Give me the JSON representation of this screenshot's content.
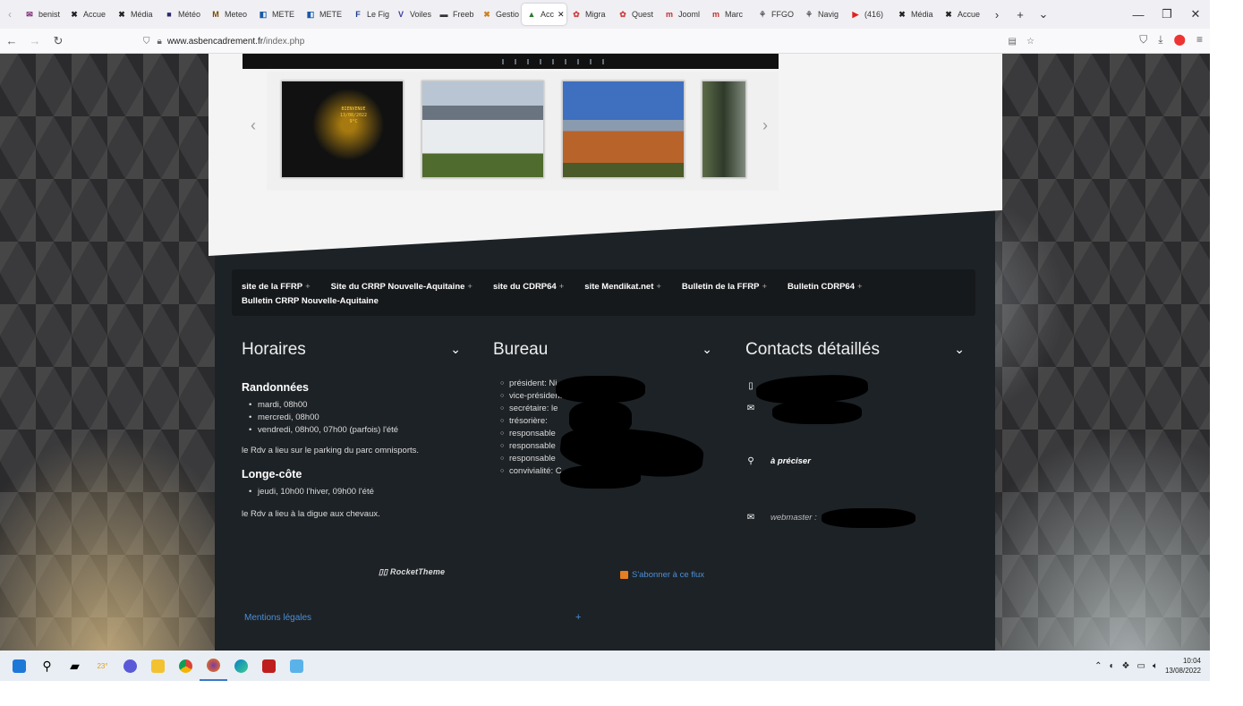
{
  "browser": {
    "tabs": [
      {
        "label": "benist",
        "color": "#7a1e6e",
        "glyph": "✉"
      },
      {
        "label": "Accue",
        "color": "#222",
        "glyph": "✖"
      },
      {
        "label": "Média",
        "color": "#222",
        "glyph": "✖"
      },
      {
        "label": "Météo",
        "color": "#2a2a6e",
        "glyph": "■"
      },
      {
        "label": "Meteo",
        "color": "#7a4a00",
        "glyph": "M"
      },
      {
        "label": "METE",
        "color": "#1a5aa8",
        "glyph": "◧"
      },
      {
        "label": "METE",
        "color": "#1a5aa8",
        "glyph": "◧"
      },
      {
        "label": "Le Fig",
        "color": "#1a3a8a",
        "glyph": "F"
      },
      {
        "label": "Voiles",
        "color": "#3a3aa8",
        "glyph": "V"
      },
      {
        "label": "Freeb",
        "color": "#333",
        "glyph": "▬"
      },
      {
        "label": "Gestio",
        "color": "#d08020",
        "glyph": "✖"
      },
      {
        "label": "Acc",
        "color": "#2a7a2a",
        "glyph": "▲"
      },
      {
        "label": "Migra",
        "color": "#d04040",
        "glyph": "✿"
      },
      {
        "label": "Quest",
        "color": "#d04040",
        "glyph": "✿"
      },
      {
        "label": "Jooml",
        "color": "#c03030",
        "glyph": "m"
      },
      {
        "label": "Marc",
        "color": "#c03030",
        "glyph": "m"
      },
      {
        "label": "FFGO",
        "color": "#555",
        "glyph": "⚘"
      },
      {
        "label": "Navig",
        "color": "#555",
        "glyph": "⚘"
      },
      {
        "label": "(416)",
        "color": "#e02020",
        "glyph": "▶"
      },
      {
        "label": "Média",
        "color": "#222",
        "glyph": "✖"
      },
      {
        "label": "Accue",
        "color": "#222",
        "glyph": "✖"
      }
    ],
    "active_tab_index": 11,
    "url_host": "www.asbencadrement.fr",
    "url_path": "/index.php"
  },
  "menu": [
    {
      "label": "site de la FFRP"
    },
    {
      "label": "Site du CRRP Nouvelle-Aquitaine"
    },
    {
      "label": "site du CDRP64"
    },
    {
      "label": "site Mendikat.net"
    },
    {
      "label": "Bulletin de la FFRP"
    },
    {
      "label": "Bulletin CDRP64"
    },
    {
      "label": "Bulletin CRRP Nouvelle-Aquitaine",
      "no_plus": true
    }
  ],
  "horaires": {
    "title": "Horaires",
    "randonnees_title": "Randonnées",
    "randonnees_items": [
      "mardi, 08h00",
      "mercredi, 08h00",
      "vendredi, 08h00, 07h00 (parfois) l'été"
    ],
    "randonnees_note": "le Rdv a lieu sur le parking du parc omnisports.",
    "longecote_title": "Longe-côte",
    "longecote_items": [
      "jeudi, 10h00 l'hiver, 09h00 l'été"
    ],
    "longecote_note": "le Rdv a lieu à la digue aux chevaux."
  },
  "bureau": {
    "title": "Bureau",
    "items": [
      "président: Ni",
      "vice-président:",
      "secrétaire: le",
      "trésorière:",
      "responsable",
      "responsable",
      "responsable",
      "convivialité: C"
    ]
  },
  "contacts": {
    "title": "Contacts détaillés",
    "address": "à préciser",
    "webmaster": "webmaster :"
  },
  "footer": {
    "rockettheme": "RocketTheme",
    "rss": "S'abonner à ce flux",
    "mentions": "Mentions légales",
    "plus": "+"
  },
  "carousel": {
    "sign_text": [
      "BIENVENUE",
      "13/08/2022",
      "9°C"
    ]
  },
  "taskbar": {
    "weather": "23°",
    "time": "10:04",
    "date": "13/08/2022"
  }
}
